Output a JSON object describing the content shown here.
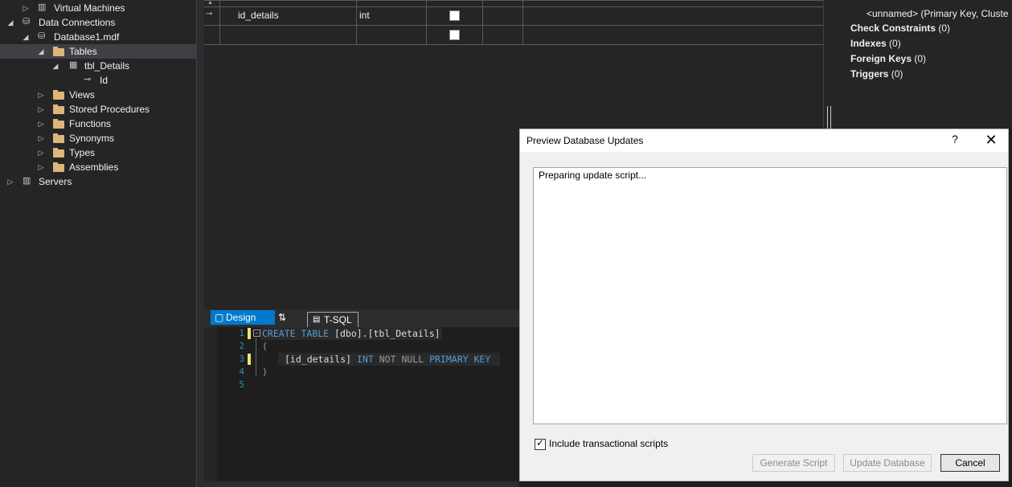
{
  "tree": {
    "items": [
      {
        "label": "Virtual Machines",
        "indent": 2,
        "icon": "server-icon",
        "toggle": "▷"
      },
      {
        "label": "Data Connections",
        "indent": 1,
        "icon": "database-connection-icon",
        "toggle": "◢"
      },
      {
        "label": "Database1.mdf",
        "indent": 2,
        "icon": "database-icon",
        "toggle": "◢"
      },
      {
        "label": "Tables",
        "indent": 3,
        "icon": "folder-icon",
        "toggle": "◢"
      },
      {
        "label": "tbl_Details",
        "indent": 4,
        "icon": "table-icon",
        "toggle": "◢"
      },
      {
        "label": "Id",
        "indent": 5,
        "icon": "key-icon",
        "toggle": ""
      },
      {
        "label": "Views",
        "indent": 3,
        "icon": "folder-icon",
        "toggle": "▷"
      },
      {
        "label": "Stored Procedures",
        "indent": 3,
        "icon": "folder-icon",
        "toggle": "▷"
      },
      {
        "label": "Functions",
        "indent": 3,
        "icon": "folder-icon",
        "toggle": "▷"
      },
      {
        "label": "Synonyms",
        "indent": 3,
        "icon": "folder-icon",
        "toggle": "▷"
      },
      {
        "label": "Types",
        "indent": 3,
        "icon": "folder-icon",
        "toggle": "▷"
      },
      {
        "label": "Assemblies",
        "indent": 3,
        "icon": "folder-icon",
        "toggle": "▷"
      },
      {
        "label": "Servers",
        "indent": 1,
        "icon": "server-icon",
        "toggle": "▷"
      }
    ]
  },
  "grid": {
    "rows": [
      {
        "name": "id_details",
        "type": "int",
        "allow_nulls": false
      }
    ]
  },
  "tabs": {
    "design": "Design",
    "tsql": "T-SQL",
    "swap": "⇅"
  },
  "editor": {
    "line_numbers": [
      "1",
      "2",
      "3",
      "4",
      "5"
    ],
    "line1_kw1": "CREATE",
    "line1_kw2": "TABLE",
    "line1_obj": "[dbo].[tbl_Details]",
    "line2": "(",
    "line3_col": "[id_details]",
    "line3_type": "INT",
    "line3_null": "NOT NULL",
    "line3_pk": "PRIMARY KEY",
    "line4": ")"
  },
  "properties": {
    "keys_sub": "<unnamed>   (Primary Key, Cluste",
    "check_constraints_label": "Check Constraints",
    "check_constraints_count": "(0)",
    "indexes_label": "Indexes",
    "indexes_count": "(0)",
    "foreign_keys_label": "Foreign Keys",
    "foreign_keys_count": "(0)",
    "triggers_label": "Triggers",
    "triggers_count": "(0)"
  },
  "dialog": {
    "title": "Preview Database Updates",
    "help": "?",
    "close": "✕",
    "status_text": "Preparing update script...",
    "include_transactional_label": "Include transactional scripts",
    "include_transactional_checked": true,
    "generate_script_label": "Generate Script",
    "update_database_label": "Update Database",
    "cancel_label": "Cancel"
  },
  "colors": {
    "accent": "#007acc",
    "panel": "#252526",
    "keyword": "#569cd6"
  }
}
